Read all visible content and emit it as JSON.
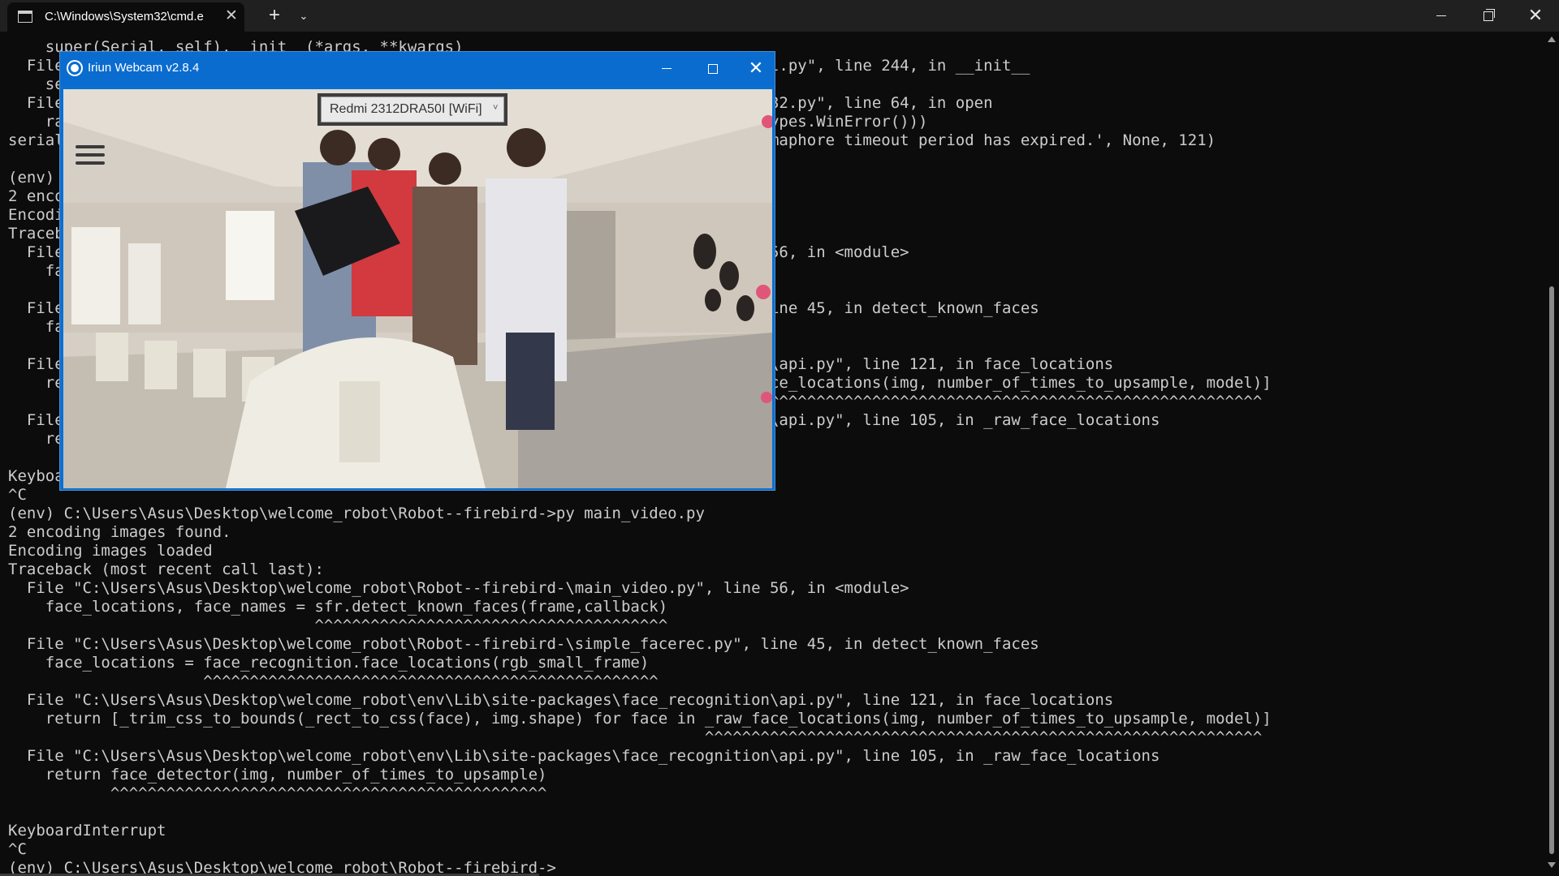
{
  "terminal": {
    "tab_title": "C:\\Windows\\System32\\cmd.e",
    "tab_close_glyph": "✕",
    "new_tab_glyph": "+",
    "dropdown_glyph": "⌄",
    "close_glyph": "✕",
    "lines": [
      "    super(Serial, self).__init__(*args, **kwargs)",
      "  File \"C:\\Users\\Asus\\Desktop\\welcome_robot\\env\\Lib\\site-packages\\serial\\serialutil.py\", line 244, in __init__",
      "    self.open()",
      "  File \"C:\\Users\\Asus\\Desktop\\welcome_robot\\env\\Lib\\site-packages\\serial\\serialwin32.py\", line 64, in open",
      "    raise SerialException(\"could not open port {!r}: {!r}\".format(self.portstr, ctypes.WinError()))",
      "serial.serialutil.SerialException: could not open port 'COM5': OSError(22, 'The semaphore timeout period has expired.', None, 121)",
      "",
      "(env) C:\\Users\\Asus\\Desktop\\welcome_robot\\Robot--firebird->py main_video.py",
      "2 encoding images found.",
      "Encoding images loaded",
      "Traceback (most recent call last):",
      "  File \"C:\\Users\\Asus\\Desktop\\welcome_robot\\Robot--firebird-\\main_video.py\", line 56, in <module>",
      "    face_locations, face_names = sfr.detect_known_faces(frame,callback)",
      "                                 ^^^^^^^^^^^^^^^^^^^^^^^^^^^^^^^^^^^^^^",
      "  File \"C:\\Users\\Asus\\Desktop\\welcome_robot\\Robot--firebird-\\simple_facerec.py\", line 45, in detect_known_faces",
      "    face_locations = face_recognition.face_locations(rgb_small_frame)",
      "                     ^^^^^^^^^^^^^^^^^^^^^^^^^^^^^^^^^^^^^^^^^^^^^^^^^",
      "  File \"C:\\Users\\Asus\\Desktop\\welcome_robot\\env\\Lib\\site-packages\\face_recognition\\api.py\", line 121, in face_locations",
      "    return [_trim_css_to_bounds(_rect_to_css(face), img.shape) for face in _raw_face_locations(img, number_of_times_to_upsample, model)]",
      "                                                                           ^^^^^^^^^^^^^^^^^^^^^^^^^^^^^^^^^^^^^^^^^^^^^^^^^^^^^^^^^^^^",
      "  File \"C:\\Users\\Asus\\Desktop\\welcome_robot\\env\\Lib\\site-packages\\face_recognition\\api.py\", line 105, in _raw_face_locations",
      "    return face_detector(img, number_of_times_to_upsample)",
      "",
      "KeyboardInterrupt",
      "^C",
      "(env) C:\\Users\\Asus\\Desktop\\welcome_robot\\Robot--firebird->py main_video.py",
      "2 encoding images found.",
      "Encoding images loaded",
      "Traceback (most recent call last):",
      "  File \"C:\\Users\\Asus\\Desktop\\welcome_robot\\Robot--firebird-\\main_video.py\", line 56, in <module>",
      "    face_locations, face_names = sfr.detect_known_faces(frame,callback)",
      "                                 ^^^^^^^^^^^^^^^^^^^^^^^^^^^^^^^^^^^^^^",
      "  File \"C:\\Users\\Asus\\Desktop\\welcome_robot\\Robot--firebird-\\simple_facerec.py\", line 45, in detect_known_faces",
      "    face_locations = face_recognition.face_locations(rgb_small_frame)",
      "                     ^^^^^^^^^^^^^^^^^^^^^^^^^^^^^^^^^^^^^^^^^^^^^^^^^",
      "  File \"C:\\Users\\Asus\\Desktop\\welcome_robot\\env\\Lib\\site-packages\\face_recognition\\api.py\", line 121, in face_locations",
      "    return [_trim_css_to_bounds(_rect_to_css(face), img.shape) for face in _raw_face_locations(img, number_of_times_to_upsample, model)]",
      "                                                                           ^^^^^^^^^^^^^^^^^^^^^^^^^^^^^^^^^^^^^^^^^^^^^^^^^^^^^^^^^^^^",
      "  File \"C:\\Users\\Asus\\Desktop\\welcome_robot\\env\\Lib\\site-packages\\face_recognition\\api.py\", line 105, in _raw_face_locations",
      "    return face_detector(img, number_of_times_to_upsample)",
      "           ^^^^^^^^^^^^^^^^^^^^^^^^^^^^^^^^^^^^^^^^^^^^^^^",
      "",
      "KeyboardInterrupt",
      "^C",
      "(env) C:\\Users\\Asus\\Desktop\\welcome_robot\\Robot--firebird->"
    ]
  },
  "iriun": {
    "title": "Iriun Webcam v2.8.4",
    "close_glyph": "✕",
    "device": "Redmi 2312DRA50I [WiFi]",
    "device_chevron": "˅",
    "accent_color": "#0a6ccf",
    "menu_icon": "hamburger-menu-icon"
  },
  "colors": {
    "terminal_bg": "#0c0c0c",
    "terminal_text": "#cccccc",
    "tabbar_bg": "#202020"
  }
}
